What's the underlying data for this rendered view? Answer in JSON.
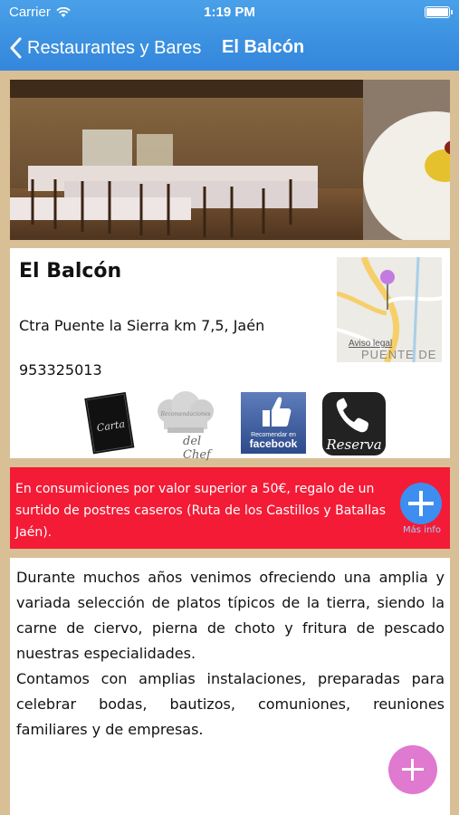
{
  "status_bar": {
    "carrier": "Carrier",
    "time": "1:19 PM",
    "wifi_icon": "wifi-icon",
    "battery_icon": "battery-icon"
  },
  "nav": {
    "back_label": "Restaurantes y Bares",
    "title": "El Balcón",
    "back_icon": "chevron-left-icon"
  },
  "restaurant": {
    "name": "El Balcón",
    "address": "Ctra Puente la Sierra km 7,5, Jaén",
    "phone": "953325013"
  },
  "map": {
    "legal": "Aviso legal",
    "place": "PUENTE DE",
    "pin_icon": "map-pin-icon"
  },
  "actions": {
    "chef_line1": "Recomendaciones",
    "chef_line2": "del Chef",
    "facebook_small": "Recomendar en",
    "facebook_brand": "facebook",
    "carta_label": "Carta",
    "reserva_label": "Reserva"
  },
  "promo": {
    "text": "En consumiciones por valor superior a 50€, regalo de un surtido de postres caseros (Ruta de los Castillos y Batallas Jaén).",
    "more_label": "Más info"
  },
  "description": {
    "paragraph1": "Durante muchos años venimos ofreciendo una amplia y variada selección de platos típicos de la tierra, siendo la carne de ciervo, pierna de choto y fritura de pescado nuestras especialidades.",
    "paragraph2": "Contamos con amplias instalaciones, preparadas para celebrar bodas, bautizos, comuniones, reuniones familiares y de empresas."
  },
  "colors": {
    "nav_blue": "#3f96e3",
    "promo_red": "#f41b36",
    "fab_pink": "#e079d0",
    "page_beige": "#d8bf96"
  }
}
